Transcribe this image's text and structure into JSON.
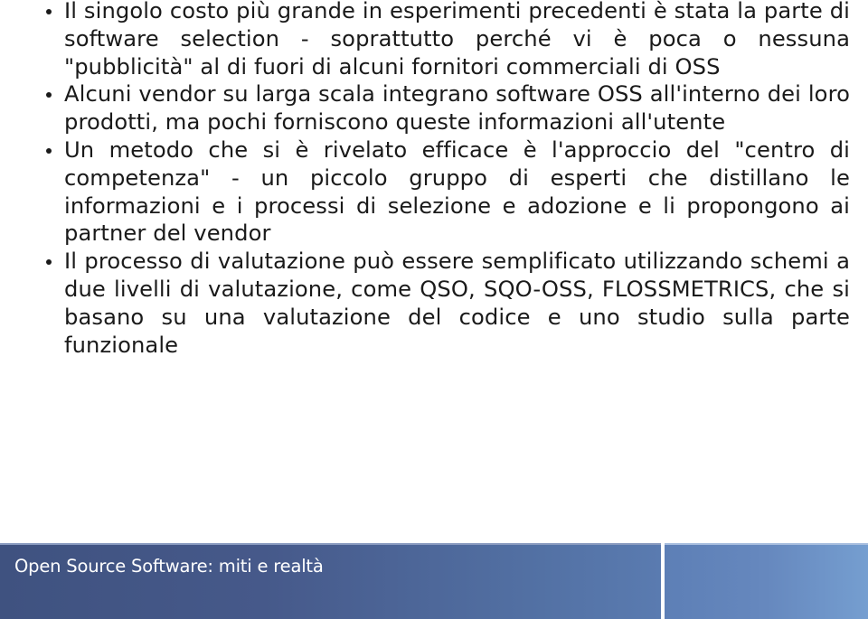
{
  "slide": {
    "bullets": [
      {
        "text": "Il singolo costo più grande in esperimenti precedenti è stata la parte di software selection - soprattutto perché vi è poca o nessuna \"pubblicità\" al di fuori di alcuni fornitori commerciali di OSS"
      },
      {
        "text": "Alcuni vendor su larga scala integrano software OSS all'interno dei loro prodotti, ma pochi forniscono queste informazioni all'utente"
      },
      {
        "text": "Un metodo che si è rivelato efficace è l'approccio del \"centro di competenza\" - un piccolo gruppo di esperti che distillano le informazioni e i processi di selezione e adozione e li propongono ai partner del vendor"
      },
      {
        "text": "Il processo di valutazione può essere semplificato utilizzando schemi a due livelli di valutazione, come QSO, SQO-OSS, FLOSSMETRICS, che si basano su una valutazione del codice e uno studio sulla parte funzionale"
      }
    ]
  },
  "footer": {
    "title": "Open Source Software: miti e realtà"
  },
  "colors": {
    "footer_dark": "#3f5280",
    "footer_light": "#759ed0",
    "text": "#1a1a1a"
  }
}
